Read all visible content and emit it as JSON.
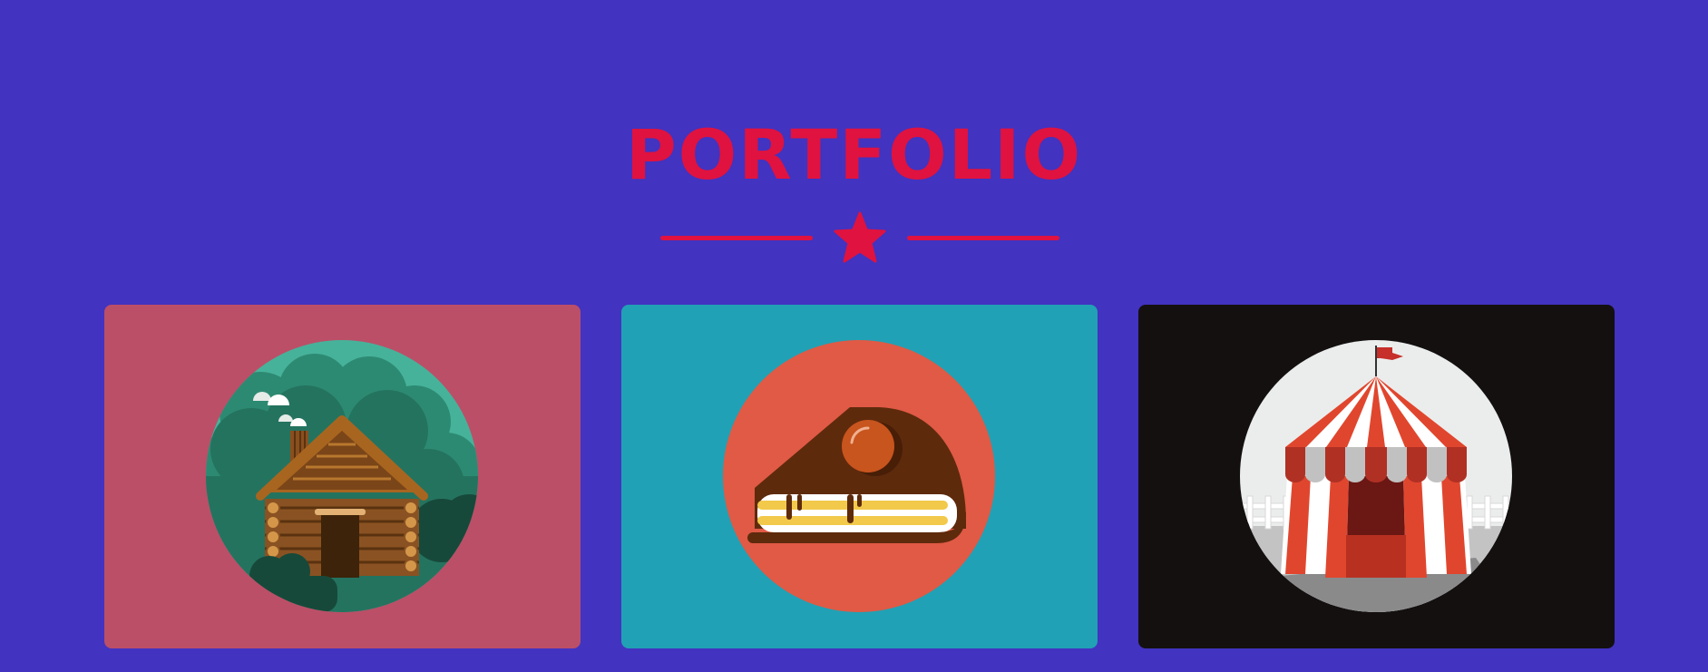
{
  "section": {
    "title": "PORTFOLIO"
  },
  "colors": {
    "background": "#4233c0",
    "accent": "#e0123f"
  },
  "divider": {
    "icon": "star-icon"
  },
  "portfolio_items": [
    {
      "icon": "log-cabin-illustration",
      "background": "#bb4f67",
      "circle": "#46b29a"
    },
    {
      "icon": "cake-slice-illustration",
      "background": "#21a1b5",
      "circle": "#e05a45"
    },
    {
      "icon": "circus-tent-illustration",
      "background": "#141010",
      "circle": "#ebeded"
    }
  ]
}
